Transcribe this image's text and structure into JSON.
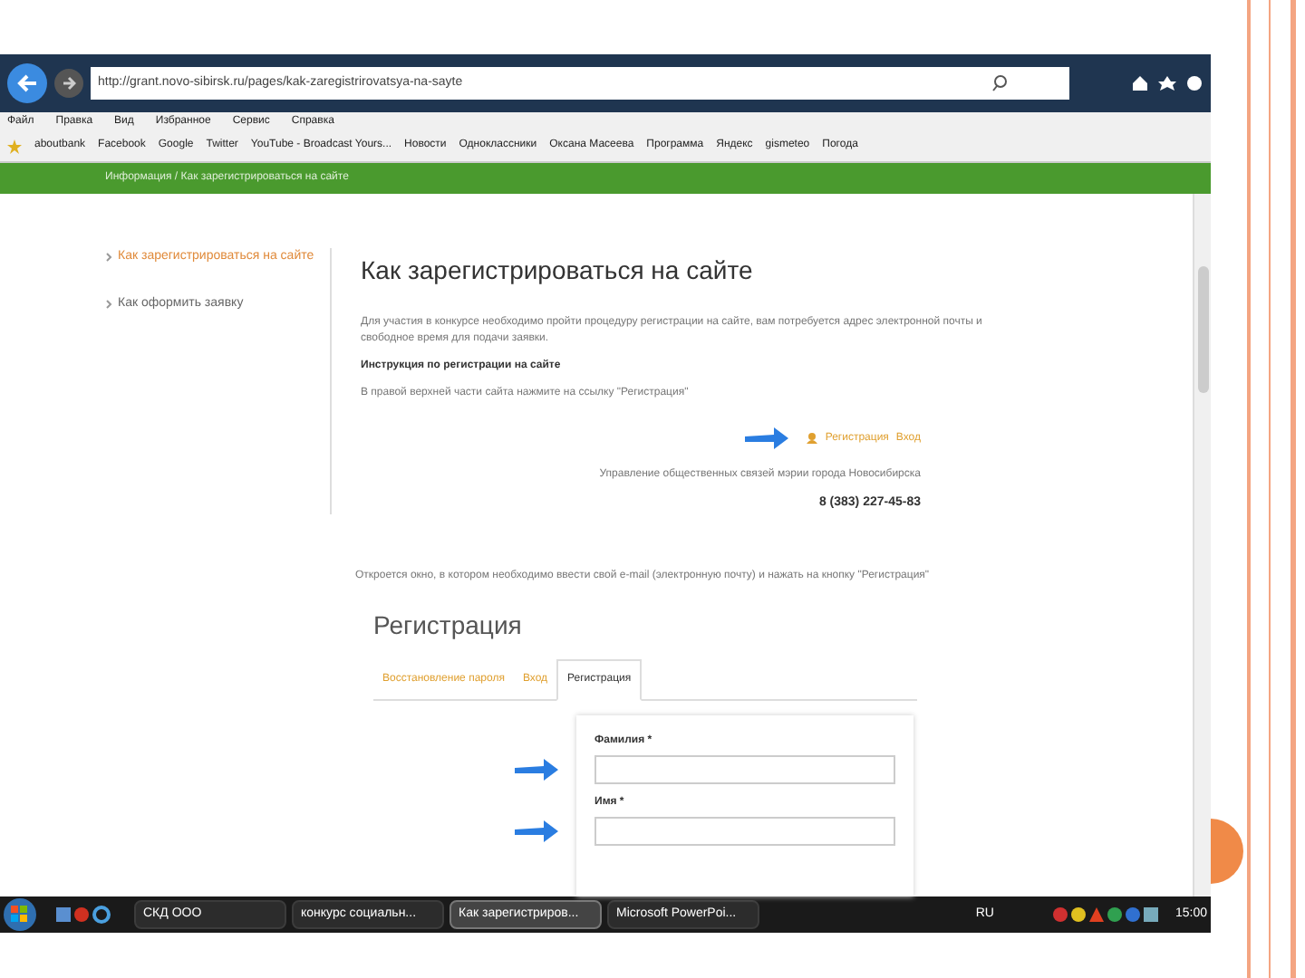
{
  "browser": {
    "address": "http://grant.novo-sibirsk.ru/pages/kak-zaregistrirovatsya-na-sayte",
    "menu": [
      "Файл",
      "Правка",
      "Вид",
      "Избранное",
      "Сервис",
      "Справка"
    ],
    "favorites": [
      "aboutbank",
      "Facebook",
      "Google",
      "Twitter",
      "YouTube - Broadcast Yours...",
      "Новости",
      "Одноклассники",
      "Оксана Масеева",
      "Программа",
      "Яндекс",
      "gismeteo",
      "Погода"
    ]
  },
  "breadcrumb": "Информация / Как зарегистрироваться на сайте",
  "sidebar": {
    "items": [
      {
        "label": "Как зарегистрироваться на сайте",
        "selected": true
      },
      {
        "label": "Как оформить заявку",
        "selected": false
      }
    ]
  },
  "article": {
    "title": "Как зарегистрироваться на сайте",
    "intro": "Для участия в конкурсе необходимо пройти процедуру регистрации на сайте, вам потребуется адрес электронной почты и свободное время для подачи заявки.",
    "subtitle": "Инструкция по регистрации на сайте",
    "step": "В правой верхней части сайта нажмите на ссылку \"Регистрация\"",
    "header_links": [
      "Регистрация",
      "Вход"
    ],
    "org": "Управление общественных связей мэрии города Новосибирска",
    "phone": "8 (383) 227-45-83",
    "step2": "Откроется окно, в котором необходимо ввести свой e-mail (электронную почту) и нажать на кнопку \"Регистрация\""
  },
  "registration": {
    "title": "Регистрация",
    "tabs": [
      {
        "label": "Восстановление пароля",
        "selected": false
      },
      {
        "label": "Вход",
        "selected": false
      },
      {
        "label": "Регистрация",
        "selected": true
      }
    ],
    "fields": [
      {
        "label": "Фамилия *"
      },
      {
        "label": "Имя *"
      }
    ]
  },
  "taskbar": {
    "windows": [
      {
        "label": "СКД ООО",
        "selected": false
      },
      {
        "label": "конкурс социальн...",
        "selected": false
      },
      {
        "label": "Как зарегистриров...",
        "selected": true
      },
      {
        "label": "Microsoft PowerPoi...",
        "selected": false
      }
    ],
    "language": "RU",
    "time": "15:00"
  }
}
